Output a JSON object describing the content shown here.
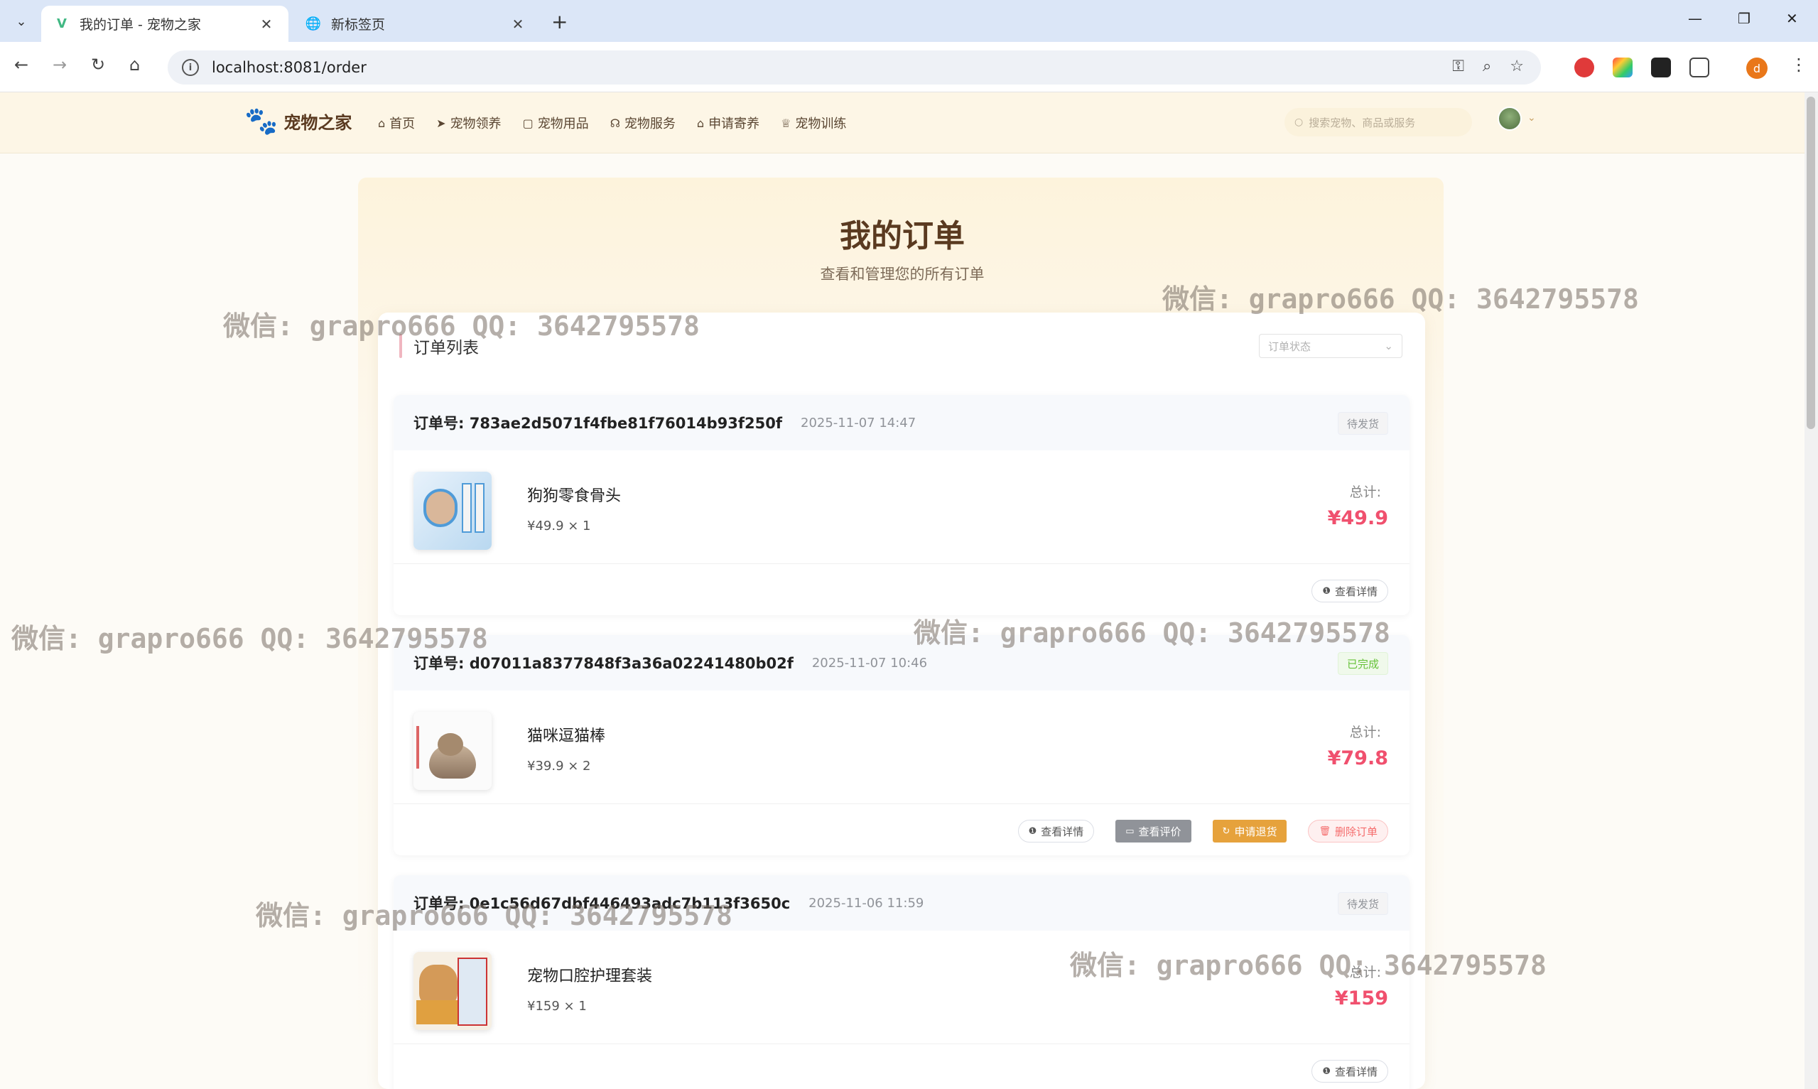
{
  "browser": {
    "tabs": [
      {
        "title": "我的订单 - 宠物之家",
        "close": "✕"
      },
      {
        "title": "新标签页",
        "close": "✕"
      }
    ],
    "new_tab": "+",
    "url": "localhost:8081/order",
    "window_controls": [
      "—",
      "❐",
      "✕"
    ],
    "profile_initial": "d"
  },
  "header": {
    "brand": "宠物之家",
    "nav": [
      {
        "label": "首页",
        "icon": "home-icon"
      },
      {
        "label": "宠物领养",
        "icon": "send-icon"
      },
      {
        "label": "宠物用品",
        "icon": "bag-icon"
      },
      {
        "label": "宠物服务",
        "icon": "headset-icon"
      },
      {
        "label": "申请寄养",
        "icon": "house-icon"
      },
      {
        "label": "宠物训练",
        "icon": "trophy-icon"
      }
    ],
    "search_placeholder": "搜索宠物、商品或服务"
  },
  "page": {
    "title": "我的订单",
    "subtitle": "查看和管理您的所有订单",
    "list_title": "订单列表",
    "status_filter_placeholder": "订单状态"
  },
  "orders": [
    {
      "order_no": "订单号: 783ae2d5071f4fbe81f76014b93f250f",
      "time": "2025-11-07 14:47",
      "status": "待发货",
      "product": "狗狗零食骨头",
      "price_qty": "¥49.9 × 1",
      "total_label": "总计:",
      "total": "¥49.9",
      "buttons": [
        "查看详情"
      ]
    },
    {
      "order_no": "订单号: d07011a8377848f3a36a02241480b02f",
      "time": "2025-11-07 10:46",
      "status": "已完成",
      "product": "猫咪逗猫棒",
      "price_qty": "¥39.9 × 2",
      "total_label": "总计:",
      "total": "¥79.8",
      "buttons": [
        "查看详情",
        "查看评价",
        "申请退货",
        "删除订单"
      ]
    },
    {
      "order_no": "订单号: 0e1c56d67dbf446493adc7b113f3650c",
      "time": "2025-11-06 11:59",
      "status": "待发货",
      "product": "宠物口腔护理套装",
      "price_qty": "¥159 × 1",
      "total_label": "总计:",
      "total": "¥159",
      "buttons": [
        "查看详情"
      ]
    }
  ],
  "watermark": "微信: grapro666 QQ: 3642795578",
  "colors": {
    "accent_price": "#f0506e",
    "brand_brown": "#5a3a20",
    "status_done": "#67c23a",
    "btn_refund": "#e6a23c"
  }
}
